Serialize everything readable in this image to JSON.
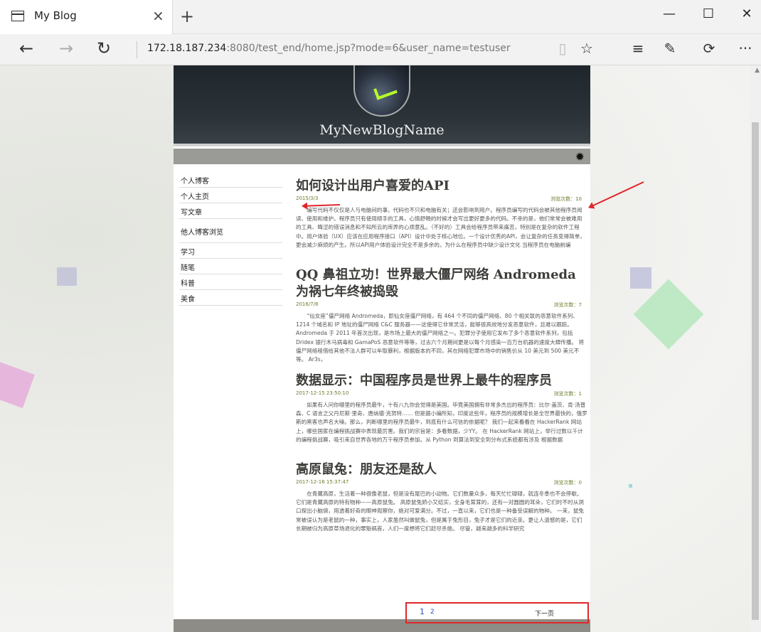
{
  "browser": {
    "tab_title": "My Blog",
    "tab_close": "×",
    "new_tab": "+",
    "minimize": "—",
    "maximize": "☐",
    "close": "✕",
    "back": "←",
    "forward": "→",
    "refresh": "↻",
    "url_host": "172.18.187.234",
    "url_rest": ":8080/test_end/home.jsp?mode=6&user_name=testuser",
    "reading_view": "▯",
    "favorite": "☆",
    "hub": "≡",
    "web_note": "✎",
    "share": "⟳",
    "more": "···"
  },
  "blog": {
    "name": "MyNewBlogName",
    "gear": "✹",
    "sidebar": [
      "个人博客",
      "个人主页",
      "写文章",
      "他人博客浏览",
      "学习",
      "随笔",
      "科普",
      "美食"
    ],
    "posts": [
      {
        "title": "如何设计出用户喜爱的API",
        "date": "2015/3/3",
        "views": "浏览次数：10",
        "body": "编写代码不仅仅是人与电脑间的事。代码也不只和电脑有关；还会影响到用户。程序员编写的代码会被其他程序员阅读、使用和维护。程序员只有使用顺手的工具，心情舒畅的时候才会写出更好更多的代码。不幸的是，他们常常会被难用的工具、晦涩的错误消息和不知所云的库弄的心烦意乱。（不好的）工具会给程序员带来痛苦，特别是在复杂的软件工程中。用户体验（UX）应该在应用程序接口（API）设计中处于核心地位。一个设计优秀的API，会让复杂的任务变得简单，更会减少麻烦的产生。所以API用户体验设计完全不是多余的。为什么在程序员中缺少设计文化 当程序员在电脑前编"
      },
      {
        "title": "QQ 鼻祖立功！世界最大僵尸网络 Andromeda 为祸七年终被捣毁",
        "date": "2016/7/8",
        "views": "浏览次数：7",
        "body": "“仙女座”僵尸网络 Andromeda，即仙女座僵尸网络，有 464 个不同的僵尸网络、80 个相关联的恶意软件系列、1214 个域名和 IP 地址的僵尸网络 C&C 服务器——这使得它非常灵活，能够很高效地分发恶意软件，且难以跟踪。Andromeda 于 2011 年首次出现，是市场上最大的僵尸网络之一。犯罪分子使用它发布了多个恶意软件系列，包括 Dridex 银行木马病毒和 GamaPoS 恶意软件等等，过去六个月期间更是以每个月感染一百万台机器的速度大肆传播。 将僵尸网络租借给其他不法人群可以牟取暴利，根据版本的不同，其在网络犯罪市场中的销售价从 10 美元到 500 美元不等。 Ar3s，"
      },
      {
        "title": "数据显示：中国程序员是世界上最牛的程序员",
        "date": "2017-12-15 23:50:10",
        "views": "浏览次数：1",
        "body": "如果有人问你哪里的程序员最牛，十有八九你会觉得是美国。毕竟美国拥有非常多杰出的程序员：比尔·盖茨、肯·汤普森、C 语言之父丹尼斯·里奇、唐纳德·克努特…… 但是据小编所知，印度这些年，程序员的规模增长是全世界最快的，俄罗斯的黑客也声名大噪。那么，判断哪里的程序员最牛，到底有什么可信的依据呢？ 我们一起来看看在 HackerRank 网站上，哪些国家在编程挑战赛中表现最厉害。我们的宗旨是：多看数据，少YY。 在 HackerRank 网站上，举行过数以千计的编程挑战赛，吸引来自世界各地的万千程序员参加。从 Python 到算法到安全到分布式系统都有涉及 根据数据"
      },
      {
        "title": "高原鼠兔：朋友还是敌人",
        "date": "2017-12-16 15:37:47",
        "views": "浏览次数：0",
        "body": "在青藏高原，生活着一种很像老鼠，但是没有尾巴的小动物。它们数量众多，每天忙忙碌碌，就连冬季也不会停歇。它们是青藏高原的特有物种——高原鼠兔。 高原鼠兔娇小又结实，全身毛茸茸的，还有一对圆圆的耳朵，它们时不时从洞口探出小脑袋，用透着好奇的眼神观察你，绝对可爱满分。不过，一直以来，它们也是一种备受误解的物种。 一来，鼠兔常被误认为是老鼠的一种，事实上，人家虽然叫做鼠兔，但是属于兔形目，兔子才是它们的近亲。更让人遗憾的是，它们长期被归为高原草场退化的罪魁祸首，人们一度想将它们赶尽杀绝。 尽管，越来越多的科学研究"
      }
    ],
    "pager": {
      "page1": "1",
      "page2": "2",
      "next": "下一页"
    }
  }
}
